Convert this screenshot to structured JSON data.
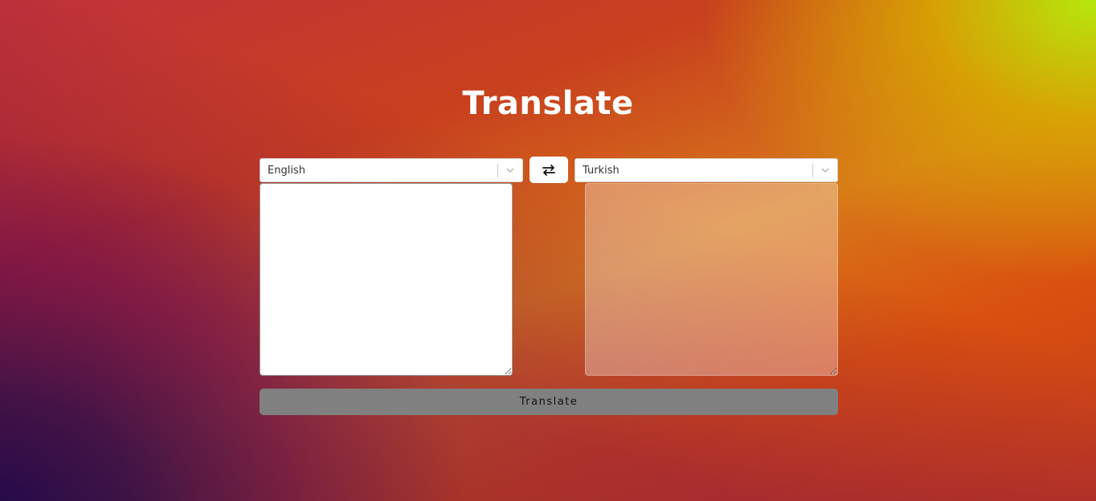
{
  "page": {
    "title": "Translate"
  },
  "source": {
    "language": "English",
    "text": ""
  },
  "target": {
    "language": "Turkish",
    "text": ""
  },
  "swap": {
    "icon": "swap-arrows-icon"
  },
  "action": {
    "translate_label": "Translate"
  },
  "colors": {
    "button_bg": "#808080",
    "title_text": "#ffffff"
  }
}
